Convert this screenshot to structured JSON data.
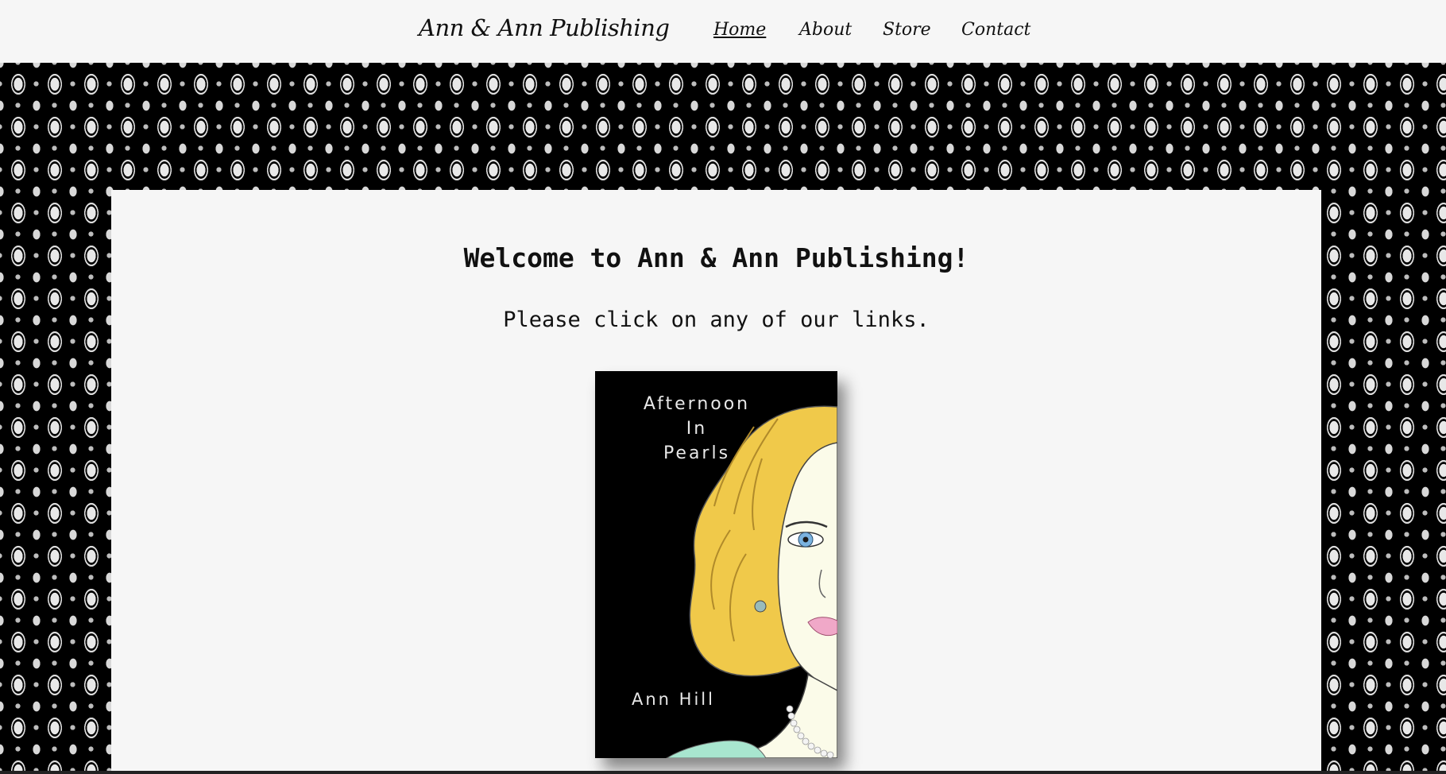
{
  "header": {
    "brand": "Ann & Ann Publishing",
    "nav": [
      {
        "label": "Home",
        "active": true
      },
      {
        "label": "About",
        "active": false
      },
      {
        "label": "Store",
        "active": false
      },
      {
        "label": "Contact",
        "active": false
      }
    ]
  },
  "main": {
    "heading": "Welcome to Ann & Ann Publishing!",
    "subtext": "Please click on any of our links.",
    "book": {
      "title_lines": [
        "Afternoon",
        "In",
        "Pearls"
      ],
      "author": "Ann Hill"
    }
  },
  "colors": {
    "background": "#f6f6f6",
    "pattern_dark": "#000000",
    "pattern_light": "#e8e8e8",
    "hair": "#f0c94a",
    "eye": "#7ab3e0",
    "lips": "#f0a8c8"
  }
}
